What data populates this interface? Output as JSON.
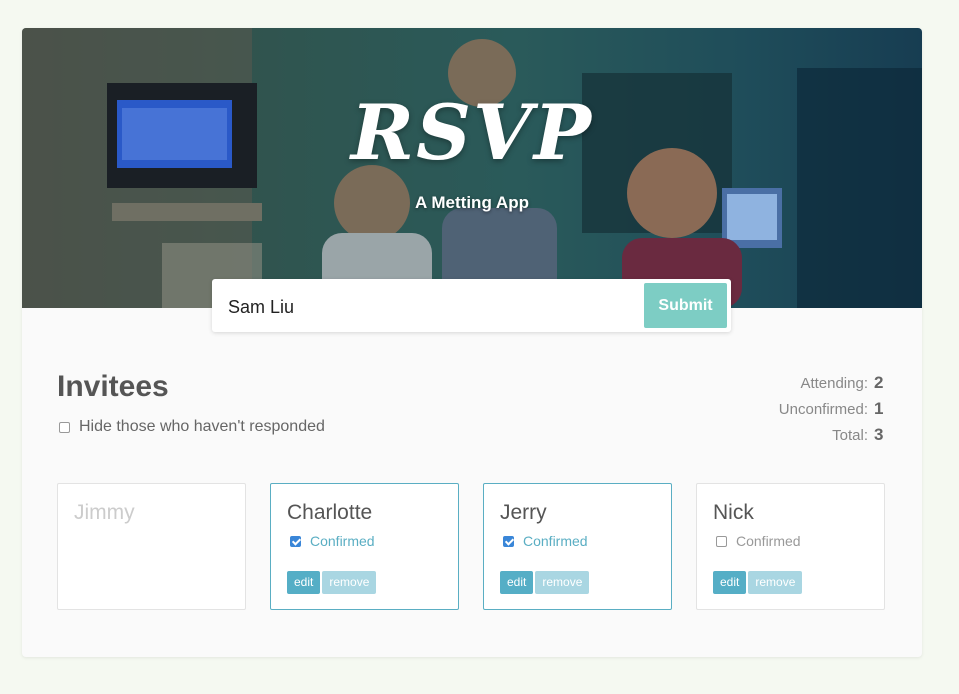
{
  "header": {
    "title": "RSVP",
    "subtitle": "A Metting App"
  },
  "form": {
    "input_value": "Sam Liu",
    "submit_label": "Submit"
  },
  "invitees": {
    "heading": "Invitees",
    "filter_label": "Hide those who haven't responded",
    "filter_checked": false
  },
  "stats": [
    {
      "label": "Attending:",
      "value": "2"
    },
    {
      "label": "Unconfirmed:",
      "value": "1"
    },
    {
      "label": "Total:",
      "value": "3"
    }
  ],
  "cards": [
    {
      "name": "Jimmy",
      "responded": false
    },
    {
      "name": "Charlotte",
      "responded": true,
      "confirmed": true,
      "confirmed_label": "Confirmed",
      "edit_label": "edit",
      "remove_label": "remove"
    },
    {
      "name": "Jerry",
      "responded": true,
      "confirmed": true,
      "confirmed_label": "Confirmed",
      "edit_label": "edit",
      "remove_label": "remove"
    },
    {
      "name": "Nick",
      "responded": true,
      "confirmed": false,
      "confirmed_label": "Confirmed",
      "edit_label": "edit",
      "remove_label": "remove"
    }
  ],
  "colors": {
    "accent": "#7dcdc4",
    "edit": "#55aec6",
    "remove": "#a9d6e2",
    "border_responded": "#5aaec3"
  }
}
